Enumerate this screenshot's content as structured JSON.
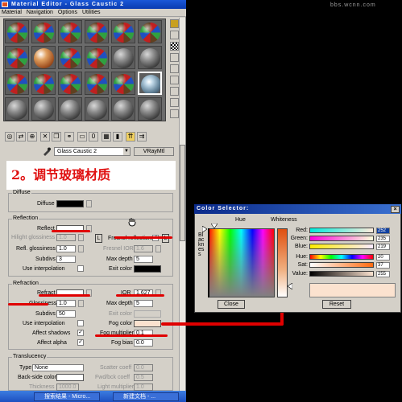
{
  "watermark": "bbs.wcnn.com",
  "editor": {
    "title": "Material Editor - Glass Caustic 2",
    "menus": [
      "Material",
      "Navigation",
      "Options",
      "Utilities"
    ],
    "material_name": "Glass Caustic 2",
    "material_type": "VRayMtl",
    "annotation": "2。调节玻璃材质"
  },
  "diffuse": {
    "group": "Diffuse",
    "label": "Diffuse"
  },
  "reflection": {
    "group": "Reflection",
    "reflect": "Reflect",
    "hilight_gloss": "Hilight glossiness",
    "hilight_gloss_val": "1.0",
    "refl_gloss": "Refl. glossiness",
    "refl_gloss_val": "1.0",
    "subdivs": "Subdivs",
    "subdivs_val": "3",
    "use_interp": "Use interpolation",
    "lock_btn": "L",
    "fresnel": "Fresnel reflections",
    "fresnel_ior": "Fresnel IOR",
    "fresnel_ior_val": "1.6",
    "max_depth": "Max depth",
    "max_depth_val": "5",
    "exit_color": "Exit color"
  },
  "refraction": {
    "group": "Refraction",
    "refract": "Refract",
    "ior": "IOR",
    "ior_val": "1.627",
    "glossiness": "Glossiness",
    "glossiness_val": "1.0",
    "max_depth": "Max depth",
    "max_depth_val": "5",
    "subdivs": "Subdivs",
    "subdivs_val": "50",
    "exit_color": "Exit color",
    "use_interp": "Use interpolation",
    "fog_color": "Fog color",
    "affect_shadows": "Affect shadows",
    "fog_mult": "Fog multiplier",
    "fog_mult_val": "0.1",
    "affect_alpha": "Affect alpha",
    "fog_bias": "Fog bias",
    "fog_bias_val": "0.0"
  },
  "translucency": {
    "group": "Translucency",
    "type": "Type",
    "type_val": "None",
    "scatter": "Scatter coeff",
    "scatter_val": "0.0",
    "backside": "Back-side color",
    "fwd": "Fwd/bck coeff",
    "fwd_val": "0.5",
    "thickness": "Thickness",
    "thickness_val": "1000.0",
    "light_mult": "Light multiplier",
    "light_mult_val": "1.0"
  },
  "taskbar": [
    "搜索结果 - Micro...",
    "新建文档 - ..."
  ],
  "color_selector": {
    "title": "Color Selector:",
    "hue_label": "Hue",
    "whiteness_label": "Whiteness",
    "blackness_label": "Blackness",
    "red_label": "Red:",
    "red_val": "252",
    "green_label": "Green:",
    "green_val": "235",
    "blue_label": "Blue:",
    "blue_val": "219",
    "hue2_label": "Hue:",
    "hue2_val": "20",
    "sat_label": "Sat:",
    "sat_val": "37",
    "value_label": "Value:",
    "value_val": "255",
    "close_btn": "Close",
    "reset_btn": "Reset",
    "preview_color": "#fbe2cf"
  }
}
